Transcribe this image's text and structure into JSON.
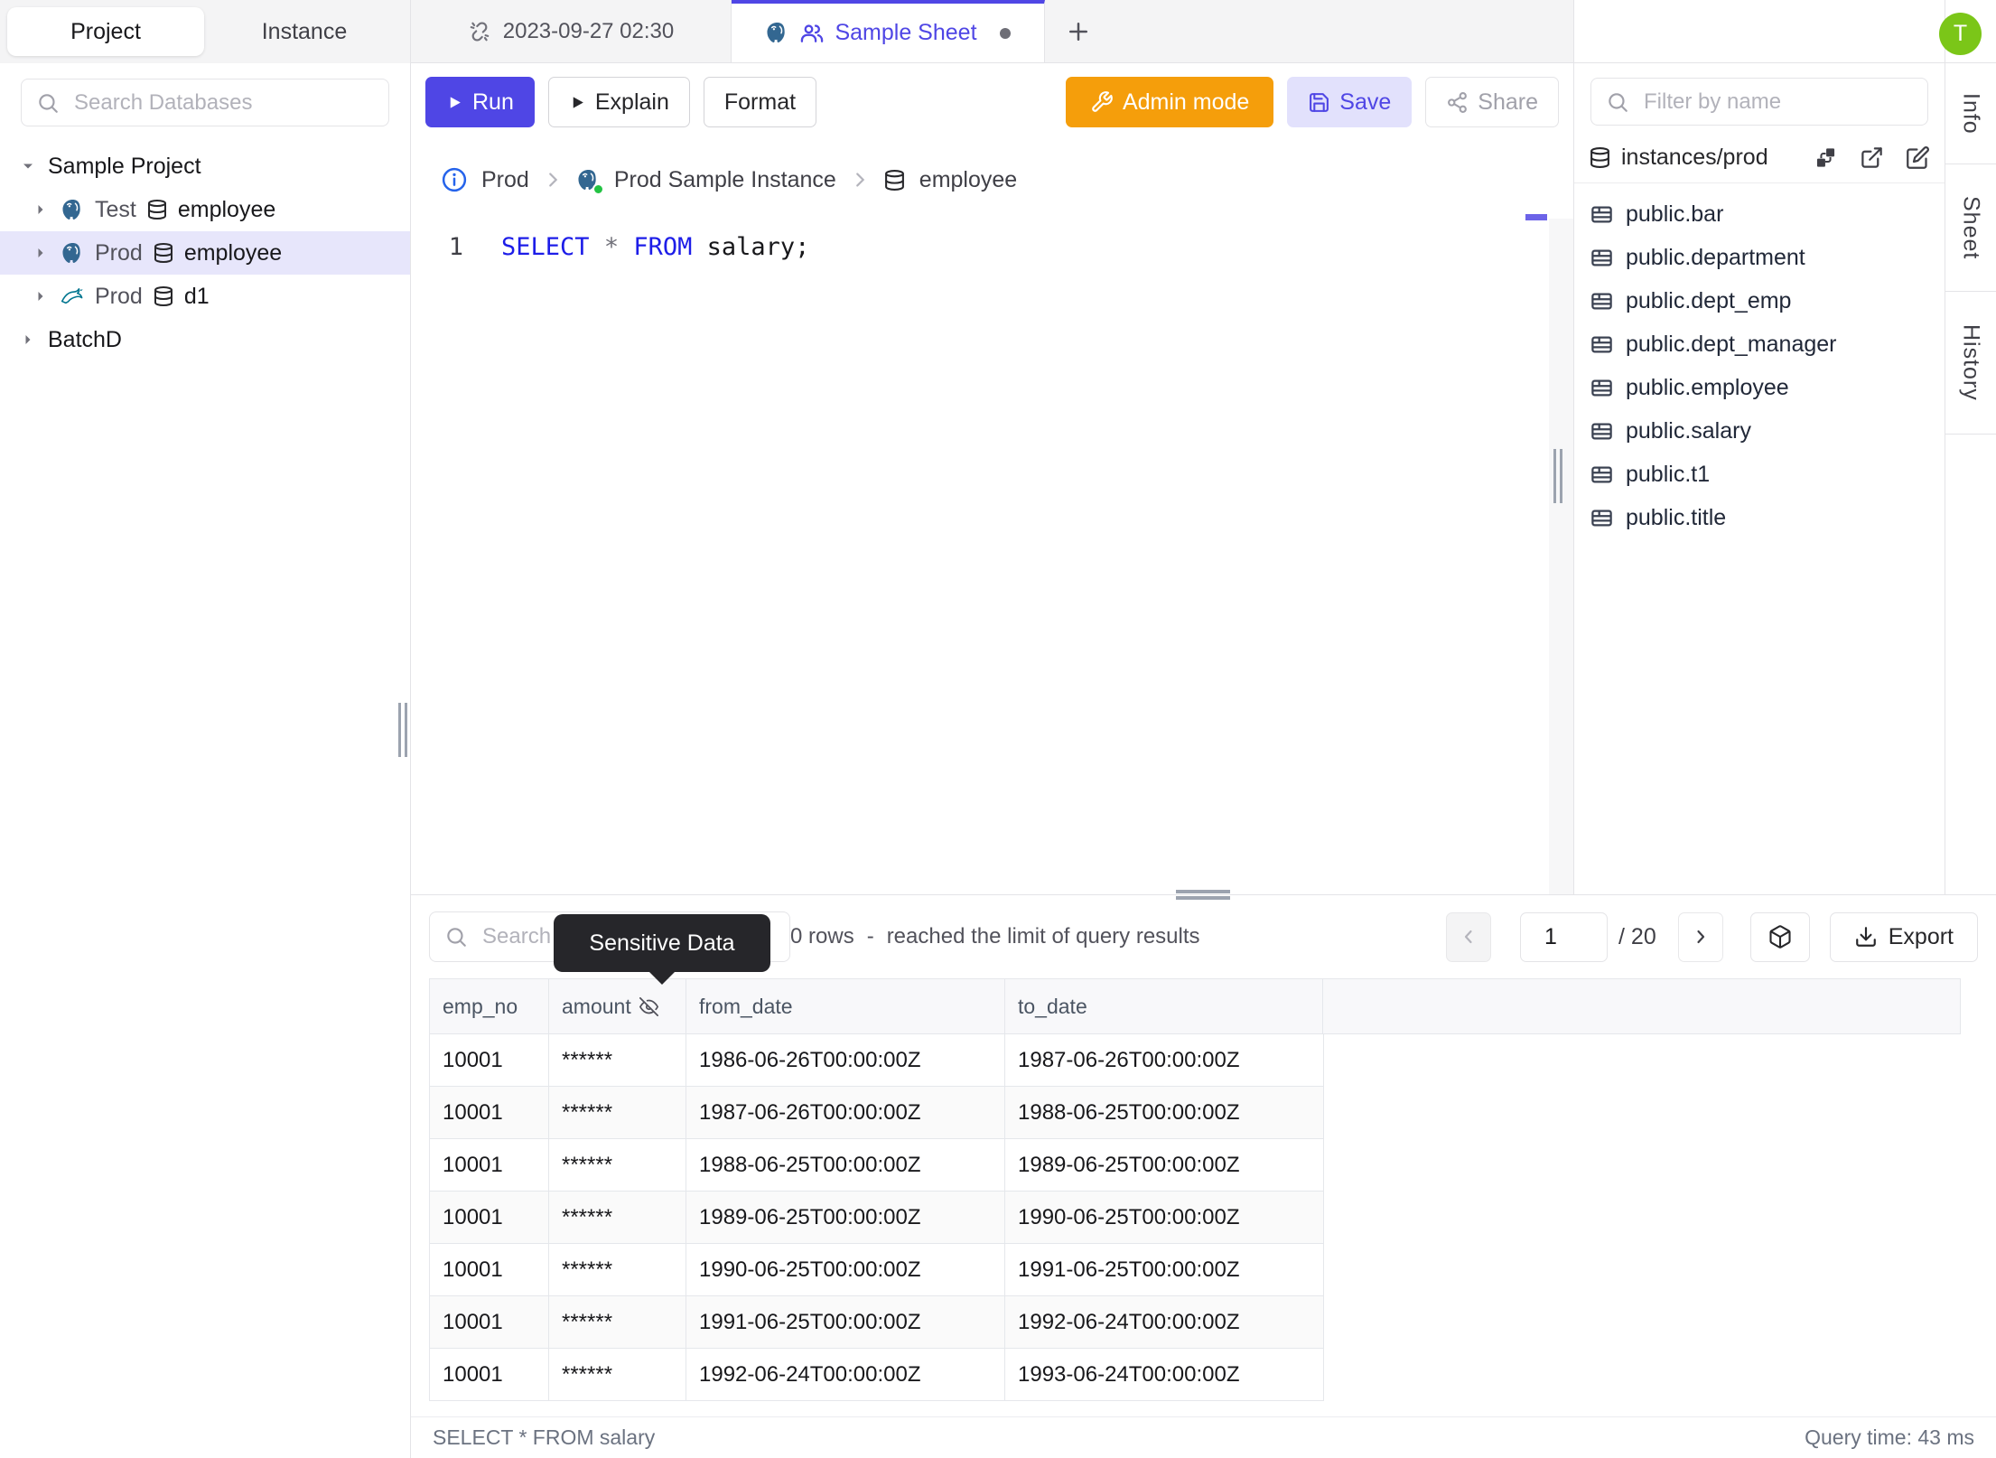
{
  "colors": {
    "accent": "#4f46e5",
    "admin_orange": "#f59e0b",
    "avatar_green": "#7bc618",
    "status_green": "#23c343",
    "keyword_blue": "#1d1de8",
    "selected_row_bg": "#e7e6fb",
    "tooltip_bg": "#26262a"
  },
  "icons": {
    "search": "magnifier",
    "unlink": "broken-chain",
    "postgresql": "elephant",
    "mysql": "dolphin",
    "database": "cylinder",
    "table": "grid",
    "users": "group-of-people",
    "play": "triangle",
    "wrench": "tool",
    "save": "floppy-disk",
    "share": "share-nodes",
    "info": "circled-i",
    "eye_off": "crossed-eye",
    "download": "arrow-into-tray",
    "box": "package",
    "schema": "diagram-squares",
    "external_link": "arrow-out-of-box",
    "edit": "pencil-square"
  },
  "left_sidebar": {
    "tab_project": "Project",
    "tab_instance": "Instance",
    "search_placeholder": "Search Databases",
    "tree": [
      {
        "label": "Sample Project"
      },
      {
        "env": "Test",
        "db": "employee",
        "engine": "postgresql"
      },
      {
        "env": "Prod",
        "db": "employee",
        "engine": "postgresql",
        "selected": true
      },
      {
        "env": "Prod",
        "db": "d1",
        "engine": "mysql"
      },
      {
        "label": "BatchD"
      }
    ]
  },
  "tab_bar": {
    "draft_tab": "2023-09-27 02:30",
    "active_tab": "Sample Sheet",
    "add": "+"
  },
  "toolbar": {
    "run": "Run",
    "explain": "Explain",
    "format": "Format",
    "admin_mode": "Admin mode",
    "save": "Save",
    "share": "Share"
  },
  "breadcrumb": {
    "environment": "Prod",
    "instance": "Prod Sample Instance",
    "database": "employee"
  },
  "editor": {
    "line_number": "1",
    "kw_select": "SELECT",
    "star": "*",
    "kw_from": "FROM",
    "rest": "salary;"
  },
  "right_panel": {
    "filter_placeholder": "Filter by name",
    "connection": "instances/prod",
    "tables": [
      "public.bar",
      "public.department",
      "public.dept_emp",
      "public.dept_manager",
      "public.employee",
      "public.salary",
      "public.t1",
      "public.title"
    ]
  },
  "side_tabs": [
    "Info",
    "Sheet",
    "History"
  ],
  "avatar_initial": "T",
  "results": {
    "search_placeholder": "Search",
    "tooltip": "Sensitive Data",
    "row_count": "0 rows",
    "separator": "-",
    "limit_note": "reached the limit of query results",
    "page_value": "1",
    "page_total": "/ 20",
    "export": "Export",
    "masked_value": "******",
    "columns": [
      "emp_no",
      "amount",
      "from_date",
      "to_date"
    ],
    "rows": [
      [
        "10001",
        "******",
        "1986-06-26T00:00:00Z",
        "1987-06-26T00:00:00Z"
      ],
      [
        "10001",
        "******",
        "1987-06-26T00:00:00Z",
        "1988-06-25T00:00:00Z"
      ],
      [
        "10001",
        "******",
        "1988-06-25T00:00:00Z",
        "1989-06-25T00:00:00Z"
      ],
      [
        "10001",
        "******",
        "1989-06-25T00:00:00Z",
        "1990-06-25T00:00:00Z"
      ],
      [
        "10001",
        "******",
        "1990-06-25T00:00:00Z",
        "1991-06-25T00:00:00Z"
      ],
      [
        "10001",
        "******",
        "1991-06-25T00:00:00Z",
        "1992-06-24T00:00:00Z"
      ],
      [
        "10001",
        "******",
        "1992-06-24T00:00:00Z",
        "1993-06-24T00:00:00Z"
      ]
    ]
  },
  "status_bar": {
    "statement": "SELECT * FROM salary",
    "query_time": "Query time: 43 ms"
  }
}
